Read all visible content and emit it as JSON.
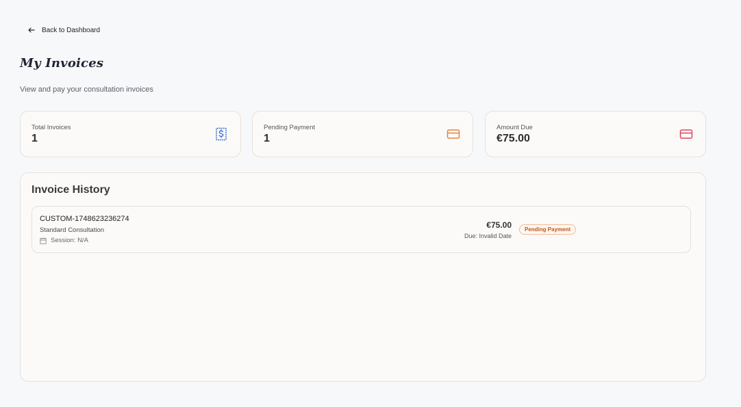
{
  "nav": {
    "back_label": "Back to Dashboard"
  },
  "header": {
    "title": "My Invoices",
    "subtitle": "View and pay your consultation invoices"
  },
  "stats": [
    {
      "label": "Total Invoices",
      "value": "1",
      "icon": "dollar-document-icon",
      "color": "#3b6fd8"
    },
    {
      "label": "Pending Payment",
      "value": "1",
      "icon": "credit-card-icon",
      "color": "#e8833a"
    },
    {
      "label": "Amount Due",
      "value": "€75.00",
      "icon": "credit-card-icon",
      "color": "#e0455a"
    }
  ],
  "history": {
    "title": "Invoice History",
    "invoices": [
      {
        "number": "CUSTOM-1748623236274",
        "type": "Standard Consultation",
        "session": "Session: N/A",
        "amount": "€75.00",
        "due": "Due: Invalid Date",
        "status": "Pending Payment",
        "status_color": "#c2571c"
      }
    ]
  }
}
